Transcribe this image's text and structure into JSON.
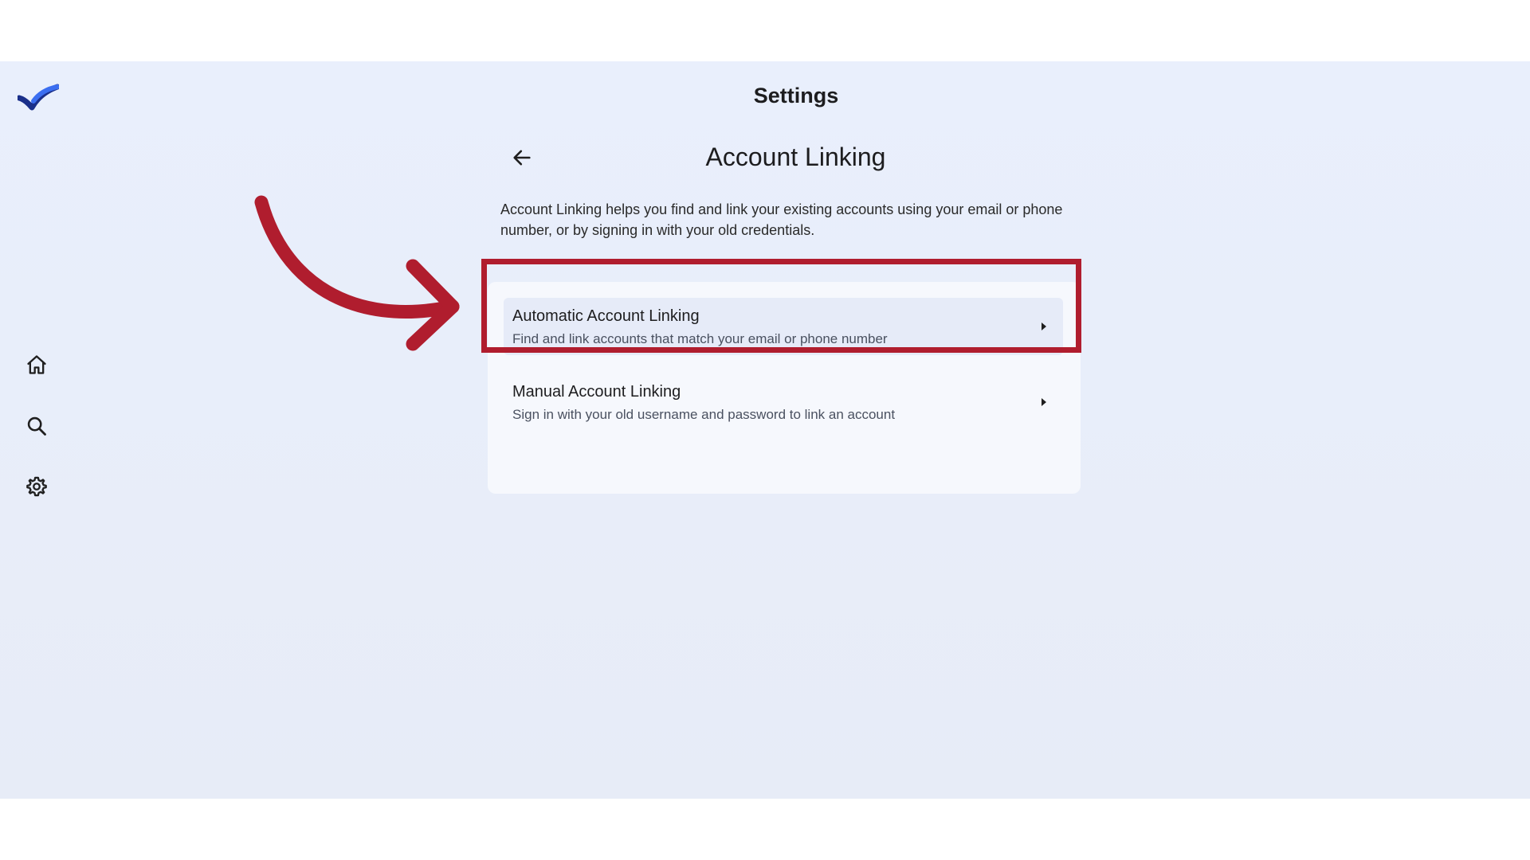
{
  "header": {
    "title": "Settings"
  },
  "sidebar": {
    "logo": "checkmark-logo",
    "items": [
      {
        "icon": "home-icon",
        "label": "Home"
      },
      {
        "icon": "search-icon",
        "label": "Search"
      },
      {
        "icon": "gear-icon",
        "label": "Settings"
      }
    ]
  },
  "page": {
    "back_icon": "arrow-left-icon",
    "section_title": "Account Linking",
    "description": "Account Linking helps you find and link your existing accounts using your email or phone number, or by signing in with your old credentials.",
    "options": [
      {
        "title": "Automatic Account Linking",
        "subtitle": "Find and link accounts that match your email or phone number",
        "highlighted": true
      },
      {
        "title": "Manual Account Linking",
        "subtitle": "Sign in with your old username and password to link an account",
        "highlighted": false
      }
    ]
  },
  "annotation": {
    "color": "#b01d2e",
    "target": "Automatic Account Linking"
  },
  "colors": {
    "brand_dark": "#1a2f8a",
    "brand_light": "#3b6ef0",
    "background": "#e9effc",
    "accent": "#b01d2e"
  }
}
